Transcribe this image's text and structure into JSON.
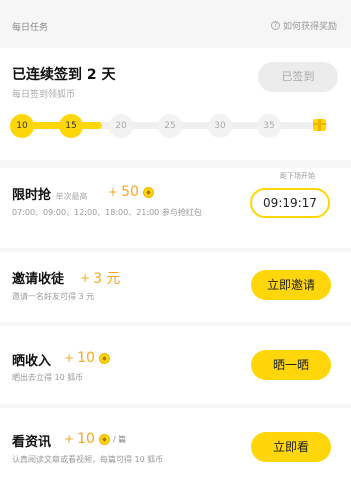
{
  "header": {
    "title": "每日任务",
    "help_icon": "help-circle-icon",
    "help_text": "如何获得奖励"
  },
  "checkin": {
    "title": "已连续签到 2 天",
    "subtitle": "每日签到领狐币",
    "signed_label": "已签到",
    "milestones": [
      "10",
      "15",
      "20",
      "25",
      "30",
      "35"
    ],
    "progress_completed_count": 2,
    "gift_icon": "gift-icon"
  },
  "tasks": {
    "flash": {
      "title": "限时抢",
      "note": "单次最高",
      "plus": "+",
      "reward": "50",
      "desc": "07:00、09:00、12:00、18:00、21:00 参与抢红包",
      "timer_label": "距下场开始",
      "timer": "09:19:17"
    },
    "invite": {
      "title": "邀请收徒",
      "plus": "+",
      "reward": "3 元",
      "desc": "邀请一名好友可得 3 元",
      "button": "立即邀请"
    },
    "income": {
      "title": "晒收入",
      "plus": "+",
      "reward": "10",
      "desc": "晒出去立得 10 狐币",
      "button": "晒一晒"
    },
    "news": {
      "title": "看资讯",
      "plus": "+",
      "reward": "10",
      "per": "/ 篇",
      "desc": "认真阅读文章或看视频，每篇可得 10 狐币",
      "button": "立即看"
    }
  },
  "colors": {
    "accent": "#ffd60a",
    "reward": "#f5a623",
    "muted": "#aaaaaa"
  }
}
